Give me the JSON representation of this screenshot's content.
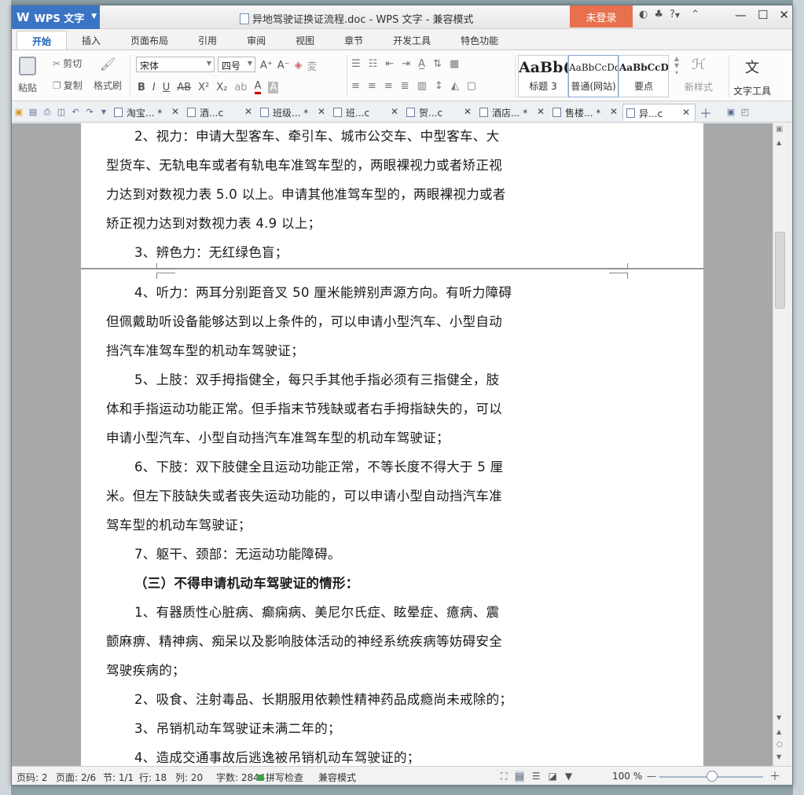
{
  "app": {
    "name": "WPS 文字"
  },
  "window": {
    "title": "异地驾驶证换证流程.doc - WPS 文字 - 兼容模式",
    "login": "未登录",
    "help": "?"
  },
  "ribbon_tabs": [
    "开始",
    "插入",
    "页面布局",
    "引用",
    "审阅",
    "视图",
    "章节",
    "开发工具",
    "特色功能"
  ],
  "clipboard": {
    "paste": "粘贴",
    "cut": "剪切",
    "copy": "复制",
    "format_painter": "格式刷"
  },
  "font": {
    "name": "宋体",
    "size": "四号"
  },
  "styles": [
    {
      "preview": "AaBb(",
      "name": "标题 3"
    },
    {
      "preview": "AaBbCcDd",
      "name": "普通(网站)"
    },
    {
      "preview": "AaBbCcD",
      "name": "要点"
    }
  ],
  "new_style": "新样式",
  "text_tools": "文字工具",
  "doc_tabs": [
    {
      "label": "淘宝... *",
      "active": false
    },
    {
      "label": "酒...c",
      "active": false
    },
    {
      "label": "班级... *",
      "active": false
    },
    {
      "label": "班...c",
      "active": false
    },
    {
      "label": "贺...c",
      "active": false
    },
    {
      "label": "酒店... *",
      "active": false
    },
    {
      "label": "售楼... *",
      "active": false
    },
    {
      "label": "异...c",
      "active": true
    }
  ],
  "document": {
    "page1_lines": [
      {
        "text": "2、视力：申请大型客车、牵引车、城市公交车、中型客车、大",
        "indent": true
      },
      {
        "text": "型货车、无轨电车或者有轨电车准驾车型的，两眼裸视力或者矫正视",
        "indent": false
      },
      {
        "text": "力达到对数视力表 5.0 以上。申请其他准驾车型的，两眼裸视力或者",
        "indent": false
      },
      {
        "text": "矫正视力达到对数视力表 4.9 以上；",
        "indent": false
      },
      {
        "text": "3、辨色力：无红绿色盲；",
        "indent": true
      }
    ],
    "page2_lines": [
      {
        "text": "4、听力：两耳分别距音叉 50 厘米能辨别声源方向。有听力障碍",
        "indent": true
      },
      {
        "text": "但佩戴助听设备能够达到以上条件的，可以申请小型汽车、小型自动",
        "indent": false
      },
      {
        "text": "挡汽车准驾车型的机动车驾驶证；",
        "indent": false
      },
      {
        "text": "5、上肢：双手拇指健全，每只手其他手指必须有三指健全，肢",
        "indent": true
      },
      {
        "text": "体和手指运动功能正常。但手指末节残缺或者右手拇指缺失的，可以",
        "indent": false
      },
      {
        "text": "申请小型汽车、小型自动挡汽车准驾车型的机动车驾驶证；",
        "indent": false
      },
      {
        "text": "6、下肢：双下肢健全且运动功能正常，不等长度不得大于 5 厘",
        "indent": true
      },
      {
        "text": "米。但左下肢缺失或者丧失运动功能的，可以申请小型自动挡汽车准",
        "indent": false
      },
      {
        "text": "驾车型的机动车驾驶证；",
        "indent": false
      },
      {
        "text": "7、躯干、颈部：无运动功能障碍。",
        "indent": true
      },
      {
        "text": "（三）不得申请机动车驾驶证的情形：",
        "indent": true,
        "bold": true
      },
      {
        "text": "1、有器质性心脏病、癫痫病、美尼尔氏症、眩晕症、癔病、震",
        "indent": true
      },
      {
        "text": "颤麻痹、精神病、痴呆以及影响肢体活动的神经系统疾病等妨碍安全",
        "indent": false
      },
      {
        "text": "驾驶疾病的；",
        "indent": false
      },
      {
        "text": "2、吸食、注射毒品、长期服用依赖性精神药品成瘾尚未戒除的；",
        "indent": true
      },
      {
        "text": "3、吊销机动车驾驶证未满二年的；",
        "indent": true
      },
      {
        "text": "4、造成交通事故后逃逸被吊销机动车驾驶证的；",
        "indent": true
      }
    ]
  },
  "status": {
    "page_code": "页码: 2",
    "pages": "页面: 2/6",
    "section": "节: 1/1",
    "row": "行: 18",
    "column": "列: 20",
    "word_count": "字数: 2844",
    "spell_check": "拼写检查",
    "compat_mode": "兼容模式",
    "zoom": "100 %",
    "zoom_level_percent": 100
  },
  "colors": {
    "app_blue": "#3b74c4",
    "login_orange": "#e8704e",
    "tab_active": "#1d62b8"
  }
}
